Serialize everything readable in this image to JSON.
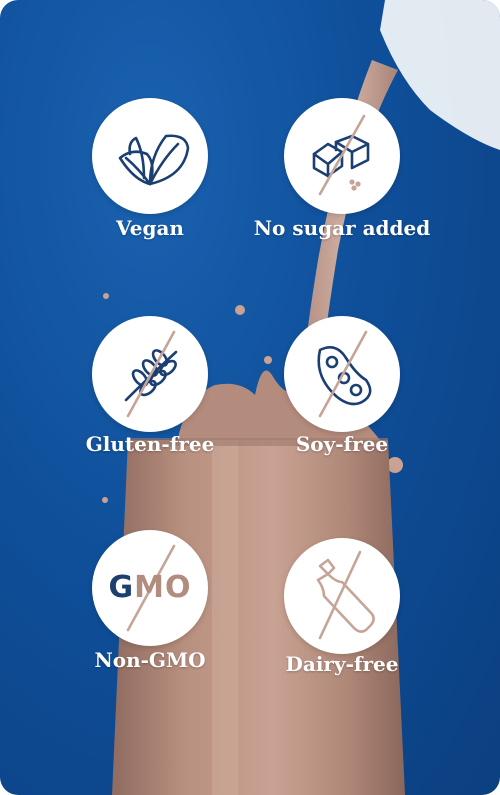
{
  "badges": [
    {
      "icon": "leaf-icon",
      "label": "Vegan"
    },
    {
      "icon": "sugar-cubes-crossed-icon",
      "label": "No sugar added"
    },
    {
      "icon": "wheat-crossed-icon",
      "label": "Gluten-free"
    },
    {
      "icon": "soybean-crossed-icon",
      "label": "Soy-free"
    },
    {
      "icon": "gmo-crossed-icon",
      "label": "Non-GMO",
      "icon_text": "GMO"
    },
    {
      "icon": "milk-bottle-crossed-icon",
      "label": "Dairy-free"
    }
  ],
  "colors": {
    "background": "#0f4f9a",
    "icon_navy": "#1b3f72",
    "icon_tan": "#c6a497",
    "drink": "#b98f80"
  }
}
